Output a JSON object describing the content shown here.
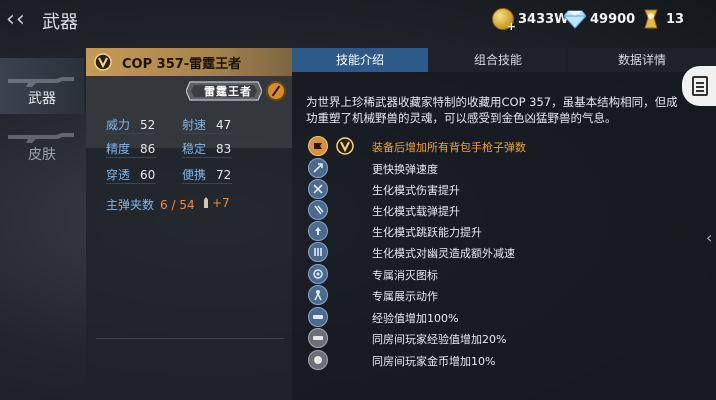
{
  "header": {
    "title": "武器",
    "gold": "3433W",
    "diamonds": "49900",
    "rank": "13"
  },
  "sidebar": {
    "items": [
      {
        "label": "武器",
        "active": true
      },
      {
        "label": "皮肤",
        "active": false
      }
    ]
  },
  "weapon": {
    "name": "COP 357-雷霆王者",
    "plate_label": "雷霆王者",
    "stats": [
      {
        "label": "威力",
        "value": "52"
      },
      {
        "label": "射速",
        "value": "47"
      },
      {
        "label": "精度",
        "value": "86"
      },
      {
        "label": "稳定",
        "value": "83"
      },
      {
        "label": "穿透",
        "value": "60"
      },
      {
        "label": "便携",
        "value": "72"
      }
    ],
    "ammo_label": "主弹夹数",
    "ammo_value": "6 / 54",
    "ammo_bonus": "+7"
  },
  "tabs": [
    {
      "label": "技能介绍",
      "active": true
    },
    {
      "label": "组合技能",
      "active": false
    },
    {
      "label": "数据详情",
      "active": false
    }
  ],
  "description": "为世界上珍稀武器收藏家特制的收藏用COP 357，虽基本结构相同，但成功重塑了机械野兽的灵魂，可以感受到金色凶猛野兽的气息。",
  "skills": [
    {
      "text": "装备后增加所有背包手枪子弹数",
      "icon": "ammo-icon",
      "highlight": true
    },
    {
      "text": "更快换弹速度",
      "icon": "reload-icon"
    },
    {
      "text": "生化模式伤害提升",
      "icon": "damage-icon"
    },
    {
      "text": "生化模式载弹提升",
      "icon": "magazine-icon"
    },
    {
      "text": "生化模式跳跃能力提升",
      "icon": "jump-icon"
    },
    {
      "text": "生化模式对幽灵造成额外减速",
      "icon": "slow-icon"
    },
    {
      "text": "专属消灭图标",
      "icon": "kill-mark-icon"
    },
    {
      "text": "专属展示动作",
      "icon": "showcase-icon"
    },
    {
      "text": "经验值增加100%",
      "icon": "exp-icon"
    },
    {
      "text": "同房间玩家经验值增加20%",
      "icon": "room-exp-icon"
    },
    {
      "text": "同房间玩家金币增加10%",
      "icon": "room-gold-icon"
    }
  ]
}
